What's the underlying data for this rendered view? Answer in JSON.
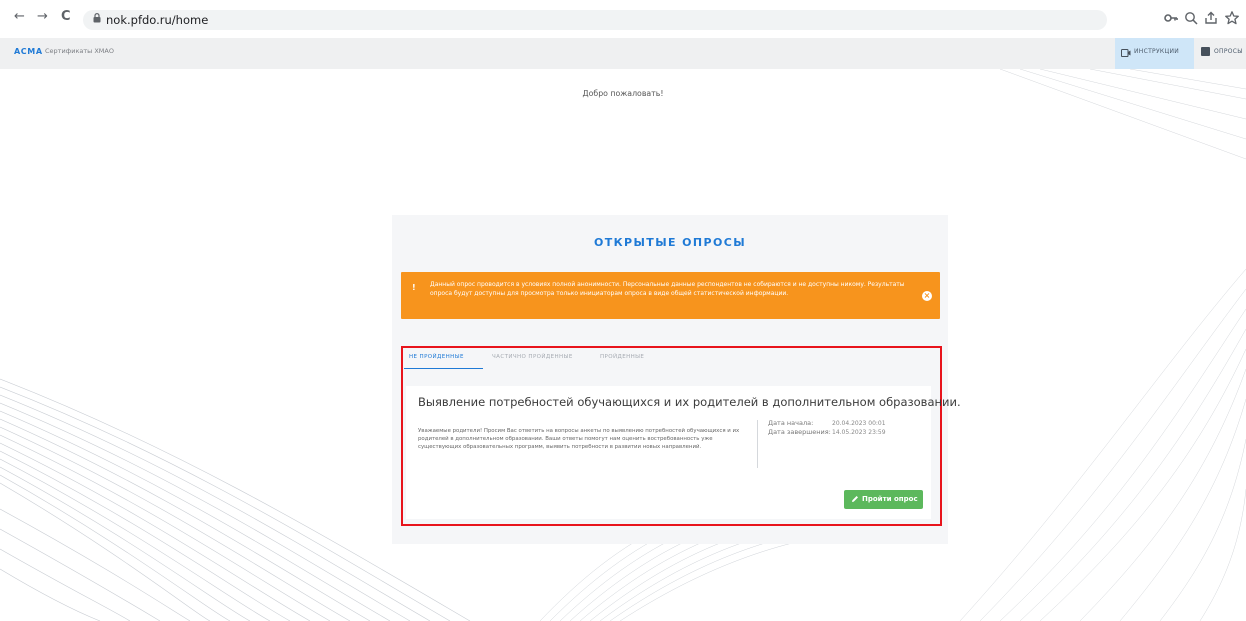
{
  "browser": {
    "url": "nok.pfdo.ru/home",
    "back_glyph": "←",
    "forward_glyph": "→",
    "reload_glyph": "C"
  },
  "header": {
    "brand": "АСМА",
    "cert_link": "Сертификаты ХМАО",
    "instructions_label": "ИНСТРУКЦИИ",
    "surveys_label": "ОПРОСЫ"
  },
  "welcome": "Добро пожаловать!",
  "open_surveys": {
    "title": "ОТКРЫТЫЕ ОПРОСЫ",
    "alert": {
      "icon_text": "!",
      "text": "Данный опрос проводится в условиях полной анонимности. Персональные данные респондентов не собираются и не доступны никому. Результаты опроса будут доступны для просмотра только инициаторам опроса в виде общей статистической информации.",
      "close_glyph": "×"
    },
    "tabs": [
      {
        "label": "НЕ ПРОЙДЕННЫЕ",
        "active": true
      },
      {
        "label": "ЧАСТИЧНО ПРОЙДЕННЫЕ",
        "active": false
      },
      {
        "label": "ПРОЙДЕННЫЕ",
        "active": false
      }
    ],
    "survey": {
      "title": "Выявление потребностей обучающихся и их родителей в дополнительном образовании.",
      "description": "Уважаемые родители! Просим Вас ответить на вопросы анкеты по выявлению потребностей обучающихся и их родителей в дополнительном образовании. Ваши ответы помогут нам оценить востребованность уже существующих образовательных программ, выявить потребности в развитии новых направлений.",
      "start_label": "Дата начала:",
      "start_value": "20.04.2023 00:01",
      "end_label": "Дата завершения:",
      "end_value": "14.05.2023 23:59",
      "button_label": "Пройти опрос"
    }
  },
  "colors": {
    "accent": "#1f7ad6",
    "alert": "#f7941d",
    "success": "#5cb85c",
    "highlight_border": "#e8141c"
  }
}
